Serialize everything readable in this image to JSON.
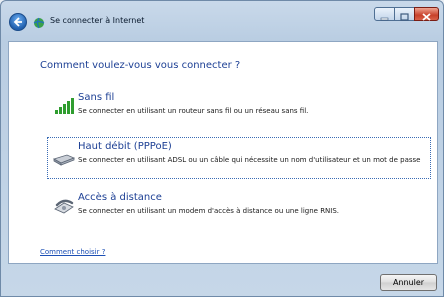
{
  "window": {
    "title": "Se connecter à Internet",
    "caption_buttons": [
      "minimize",
      "maximize",
      "close"
    ]
  },
  "main": {
    "heading": "Comment voulez-vous vous connecter ?",
    "options": [
      {
        "title": "Sans fil",
        "description": "Se connecter en utilisant un routeur sans fil ou un réseau sans fil.",
        "icon": "wireless-signal-icon",
        "selected": false
      },
      {
        "title": "Haut débit (PPPoE)",
        "description": "Se connecter en utilisant ADSL ou un câble qui nécessite un nom d'utilisateur et un mot de passe",
        "icon": "broadband-modem-icon",
        "selected": true
      },
      {
        "title": "Accès à distance",
        "description": "Se connecter en utilisant un modem d'accès à distance ou une ligne RNIS.",
        "icon": "dialup-phone-icon",
        "selected": false
      }
    ],
    "help_link": "Comment choisir ?"
  },
  "footer": {
    "cancel_label": "Annuler"
  },
  "colors": {
    "heading": "#1c3f94",
    "link": "#1c4fb5",
    "close_button": "#c8412b"
  }
}
